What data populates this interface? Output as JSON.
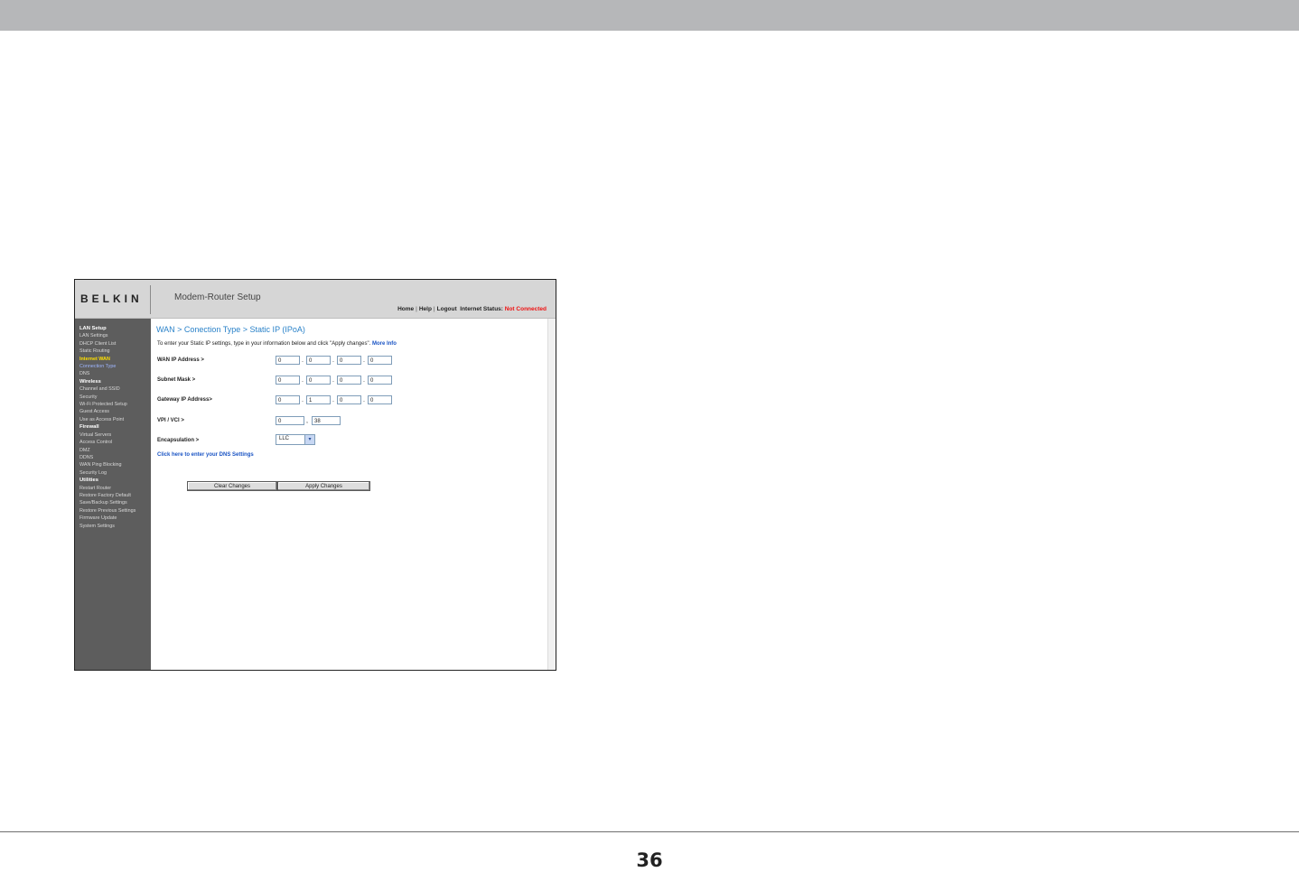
{
  "router": {
    "brand": "BELKIN",
    "title": "Modem-Router Setup",
    "nav": {
      "home": "Home",
      "help": "Help",
      "logout": "Logout",
      "status_label": "Internet Status:",
      "status_value": "Not Connected"
    },
    "sidebar": [
      {
        "label": "LAN Setup",
        "kind": "section"
      },
      {
        "label": "LAN Settings",
        "kind": "item"
      },
      {
        "label": "DHCP Client List",
        "kind": "item"
      },
      {
        "label": "Static Routing",
        "kind": "item"
      },
      {
        "label": "Internet WAN",
        "kind": "active"
      },
      {
        "label": "Connection Type",
        "kind": "current"
      },
      {
        "label": "DNS",
        "kind": "item"
      },
      {
        "label": "Wireless",
        "kind": "section"
      },
      {
        "label": "Channel and SSID",
        "kind": "item"
      },
      {
        "label": "Security",
        "kind": "item"
      },
      {
        "label": "Wi-Fi Protected Setup",
        "kind": "item"
      },
      {
        "label": "Guest Access",
        "kind": "item"
      },
      {
        "label": "Use as Access Point",
        "kind": "item"
      },
      {
        "label": "Firewall",
        "kind": "section"
      },
      {
        "label": "Virtual Servers",
        "kind": "item"
      },
      {
        "label": "Access Control",
        "kind": "item"
      },
      {
        "label": "DMZ",
        "kind": "item"
      },
      {
        "label": "DDNS",
        "kind": "item"
      },
      {
        "label": "WAN Ping Blocking",
        "kind": "item"
      },
      {
        "label": "Security Log",
        "kind": "item"
      },
      {
        "label": "Utilities",
        "kind": "section"
      },
      {
        "label": "Restart Router",
        "kind": "item"
      },
      {
        "label": "Restore Factory Default",
        "kind": "item"
      },
      {
        "label": "Save/Backup Settings",
        "kind": "item"
      },
      {
        "label": "Restore Previous Settings",
        "kind": "item"
      },
      {
        "label": "Firmware Update",
        "kind": "item"
      },
      {
        "label": "System Settings",
        "kind": "item"
      }
    ],
    "breadcrumb": "WAN > Conection Type > Static IP (IPoA)",
    "intro": "To enter your Static IP settings, type in your information below and click \"Apply changes\".",
    "more_info": "More Info",
    "fields": {
      "wan_ip": {
        "label": "WAN IP Address >",
        "values": [
          "0",
          "0",
          "0",
          "0"
        ]
      },
      "subnet": {
        "label": "Subnet Mask >",
        "values": [
          "0",
          "0",
          "0",
          "0"
        ]
      },
      "gateway": {
        "label": "Gateway IP Address>",
        "values": [
          "0",
          "1",
          "0",
          "0"
        ]
      },
      "vpi_vci": {
        "label": "VPI / VCI >",
        "vpi": "0",
        "vci": "38"
      },
      "encapsulation": {
        "label": "Encapsulation >",
        "value": "LLC"
      }
    },
    "dns_link": "Click here to enter your DNS Settings",
    "buttons": {
      "clear": "Clear Changes",
      "apply": "Apply Changes"
    }
  },
  "page_number": "36"
}
